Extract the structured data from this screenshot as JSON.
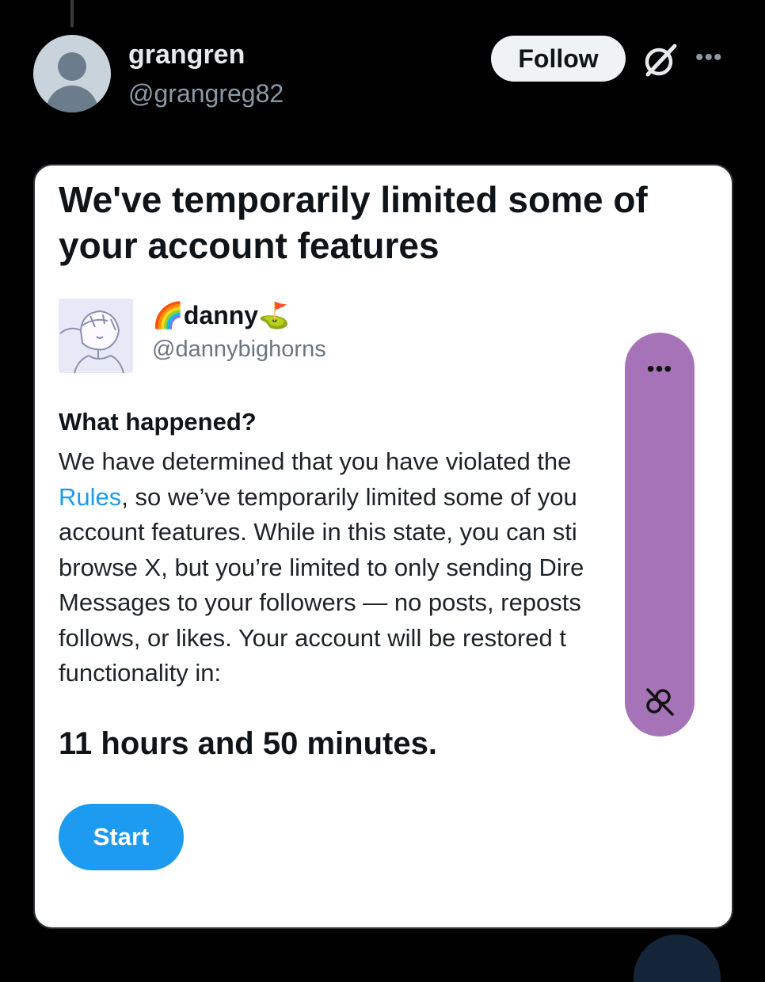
{
  "post": {
    "author_name": "grangren",
    "author_handle": "@grangreg82",
    "follow_label": "Follow",
    "more_icon": "•••"
  },
  "card": {
    "title": "We've temporarily limited some of your account features",
    "user": {
      "name_emoji_before": "🌈",
      "name": "danny",
      "name_emoji_after": "⛳",
      "handle": "@dannybighorns"
    },
    "heading": "What happened?",
    "body_lines": [
      {
        "pre": "We have determined that you have violated the ",
        "link": "",
        "post": ""
      },
      {
        "pre": "",
        "link": "Rules",
        "post": ", so we’ve temporarily limited some of you"
      },
      {
        "pre": "account features. While in this state, you can sti",
        "link": "",
        "post": ""
      },
      {
        "pre": "browse X, but you’re limited to only sending Dire",
        "link": "",
        "post": ""
      },
      {
        "pre": "Messages to your followers — no posts, reposts",
        "link": "",
        "post": ""
      },
      {
        "pre": "follows, or likes. Your account will be restored t",
        "link": "",
        "post": ""
      },
      {
        "pre": "functionality in:",
        "link": "",
        "post": ""
      }
    ],
    "countdown": "11 hours and 50 minutes.",
    "start_label": "Start"
  },
  "overlay": {
    "more_icon": "•••",
    "color": "#a673b8"
  },
  "colors": {
    "background": "#000000",
    "link": "#1d9bf0",
    "button": "#1d9bf0"
  }
}
